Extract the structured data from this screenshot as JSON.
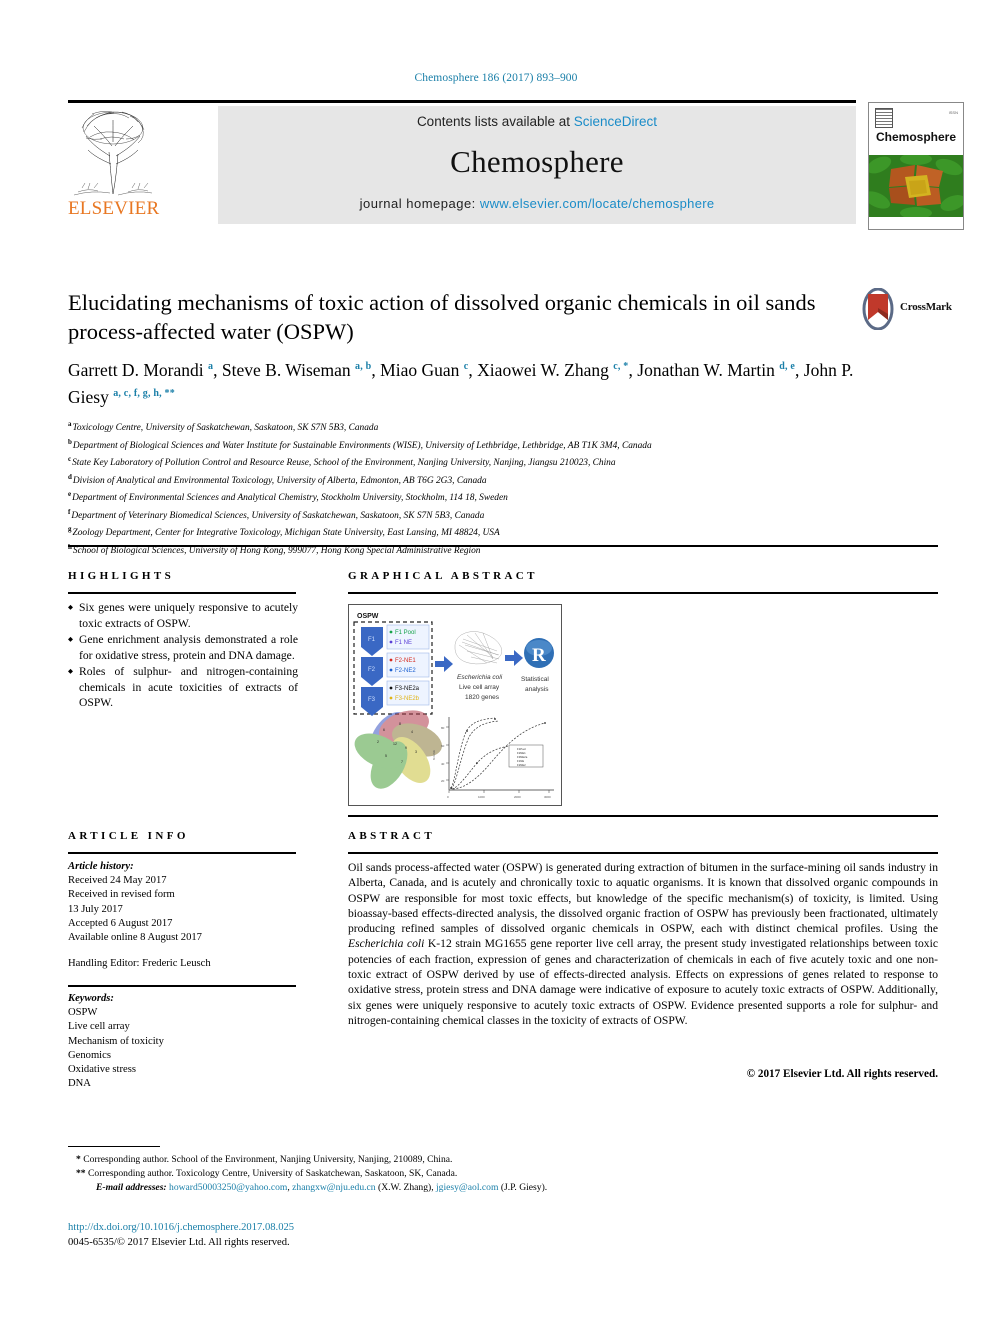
{
  "running_head": "Chemosphere 186 (2017) 893–900",
  "masthead": {
    "contents_prefix": "Contents lists available at ",
    "contents_link": "ScienceDirect",
    "journal_name": "Chemosphere",
    "homepage_prefix": "journal homepage: ",
    "homepage_link": "www.elsevier.com/locate/chemosphere",
    "publisher": "ELSEVIER",
    "cover_title": "Chemosphere",
    "link_color": "#1a8cc8",
    "publisher_color": "#e87722"
  },
  "article": {
    "title": "Elucidating mechanisms of toxic action of dissolved organic chemicals in oil sands process-affected water (OSPW)",
    "crossmark_label": "CrossMark",
    "authors_html": "Garrett D. Morandi <sup>a</sup>, Steve B. Wiseman <sup>a, b</sup>, Miao Guan <sup>c</sup>, Xiaowei W. Zhang <sup>c, *</sup>, Jonathan W. Martin <sup>d, e</sup>, John P. Giesy <sup>a, c, f, g, h, **</sup>",
    "affiliations": [
      {
        "mark": "a",
        "text": "Toxicology Centre, University of Saskatchewan, Saskatoon, SK S7N 5B3, Canada"
      },
      {
        "mark": "b",
        "text": "Department of Biological Sciences and Water Institute for Sustainable Environments (WISE), University of Lethbridge, Lethbridge, AB T1K 3M4, Canada"
      },
      {
        "mark": "c",
        "text": "State Key Laboratory of Pollution Control and Resource Reuse, School of the Environment, Nanjing University, Nanjing, Jiangsu 210023, China"
      },
      {
        "mark": "d",
        "text": "Division of Analytical and Environmental Toxicology, University of Alberta, Edmonton, AB T6G 2G3, Canada"
      },
      {
        "mark": "e",
        "text": "Department of Environmental Sciences and Analytical Chemistry, Stockholm University, Stockholm, 114 18, Sweden"
      },
      {
        "mark": "f",
        "text": "Department of Veterinary Biomedical Sciences, University of Saskatchewan, Saskatoon, SK S7N 5B3, Canada"
      },
      {
        "mark": "g",
        "text": "Zoology Department, Center for Integrative Toxicology, Michigan State University, East Lansing, MI 48824, USA"
      },
      {
        "mark": "h",
        "text": "School of Biological Sciences, University of Hong Kong, 999077, Hong Kong Special Administrative Region"
      }
    ]
  },
  "highlights": {
    "heading": "HIGHLIGHTS",
    "items": [
      "Six genes were uniquely responsive to acutely toxic extracts of OSPW.",
      "Gene enrichment analysis demonstrated a role for oxidative stress, protein and DNA damage.",
      "Roles of sulphur- and nitrogen-containing chemicals in acute toxicities of extracts of OSPW."
    ]
  },
  "graphical_abstract": {
    "heading": "GRAPHICAL ABSTRACT",
    "figure_labels": {
      "source": "OSPW",
      "stages": [
        "F1",
        "F2",
        "F3"
      ],
      "fractions": [
        "F1 Pool",
        "F1 NE",
        "F2-NE1",
        "F2-NE2",
        "F3-NE2a",
        "F3-NE2b"
      ],
      "assay_line1": "Escherichia coli",
      "assay_line2": "Live cell array",
      "assay_line3": "1820 genes",
      "analysis_icon": "R",
      "analysis_line1": "Statistical",
      "analysis_line2": "analysis"
    }
  },
  "article_info": {
    "heading": "ARTICLE INFO",
    "history_label": "Article history:",
    "history": [
      "Received 24 May 2017",
      "Received in revised form",
      "13 July 2017",
      "Accepted 6 August 2017",
      "Available online 8 August 2017"
    ],
    "handling_editor": "Handling Editor: Frederic Leusch",
    "keywords_label": "Keywords:",
    "keywords": [
      "OSPW",
      "Live cell array",
      "Mechanism of toxicity",
      "Genomics",
      "Oxidative stress",
      "DNA"
    ]
  },
  "abstract": {
    "heading": "ABSTRACT",
    "part1": "Oil sands process-affected water (OSPW) is generated during extraction of bitumen in the surface-mining oil sands industry in Alberta, Canada, and is acutely and chronically toxic to aquatic organisms. It is known that dissolved organic compounds in OSPW are responsible for most toxic effects, but knowledge of the specific mechanism(s) of toxicity, is limited. Using bioassay-based effects-directed analysis, the dissolved organic fraction of OSPW has previously been fractionated, ultimately producing refined samples of dissolved organic chemicals in OSPW, each with distinct chemical profiles. Using the ",
    "italic": "Escherichia coli",
    "part2": " K-12 strain MG1655 gene reporter live cell array, the present study investigated relationships between toxic potencies of each fraction, expression of genes and characterization of chemicals in each of five acutely toxic and one non-toxic extract of OSPW derived by use of effects-directed analysis. Effects on expressions of genes related to response to oxidative stress, protein stress and DNA damage were indicative of exposure to acutely toxic extracts of OSPW. Additionally, six genes were uniquely responsive to acutely toxic extracts of OSPW. Evidence presented supports a role for sulphur- and nitrogen-containing chemical classes in the toxicity of extracts of OSPW.",
    "copyright": "© 2017 Elsevier Ltd. All rights reserved."
  },
  "footer": {
    "corr1_mark": "*",
    "corr1": "Corresponding author. School of the Environment, Nanjing University, Nanjing, 210089, China.",
    "corr2_mark": "**",
    "corr2": "Corresponding author. Toxicology Centre, University of Saskatchewan, Saskatoon, SK, Canada.",
    "email_label": "E-mail addresses:",
    "email1": "howard50003250@yahoo.com",
    "email2": "zhangxw@nju.edu.cn",
    "email2_owner": "(X.W. Zhang)",
    "email3": "jgiesy@aol.com",
    "email3_owner": "(J.P. Giesy).",
    "doi": "http://dx.doi.org/10.1016/j.chemosphere.2017.08.025",
    "issn": "0045-6535/© 2017 Elsevier Ltd. All rights reserved."
  }
}
